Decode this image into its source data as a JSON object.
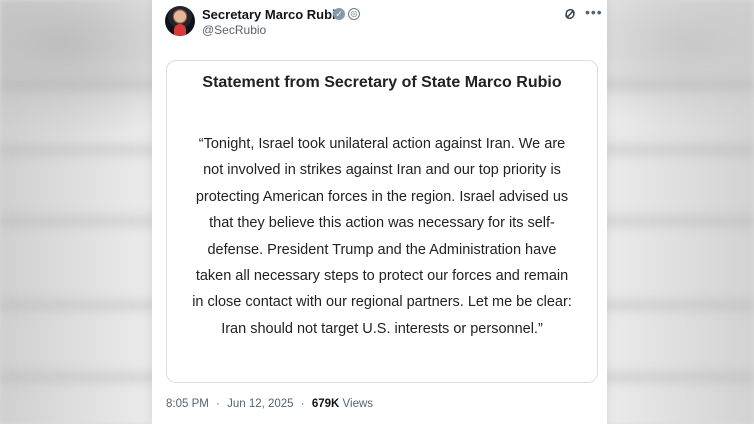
{
  "post": {
    "display_name": "Secretary Marco Rubio",
    "handle": "@SecRubio",
    "verified_icon": "verified-badge-icon",
    "government_icon": "government-badge-icon",
    "grok_icon": "grok-icon",
    "more_icon": "more-horizontal-icon",
    "statement_title": "Statement from Secretary of State Marco Rubio",
    "statement_text": "“Tonight, Israel took unilateral action against Iran. We are not involved in strikes against Iran and our top priority is protecting American forces in the region. Israel advised us that they believe this action was necessary for its self-defense. President Trump and the Administration have taken all necessary steps to protect our forces and remain in close contact with our regional partners. Let me be clear: Iran should not target U.S. interests or personnel.”",
    "time": "8:05 PM",
    "date": "Jun 12, 2025",
    "separator": "·",
    "views_count": "679K",
    "views_label": "Views"
  },
  "colors": {
    "text_primary": "#0f1419",
    "text_secondary": "#536471",
    "border": "#d9dee3",
    "background": "#ffffff"
  }
}
